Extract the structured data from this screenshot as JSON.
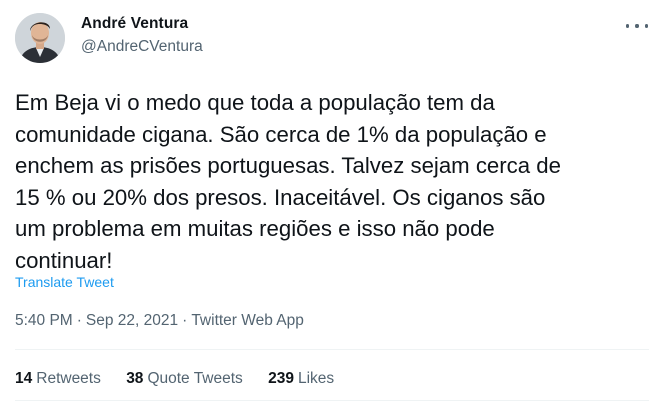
{
  "author": {
    "name": "André Ventura",
    "handle": "@AndreCVentura"
  },
  "tweet": {
    "lines": [
      "Em Beja vi o medo que toda a população tem da",
      "comunidade cigana. São cerca de 1% da população e",
      "enchem as prisões portuguesas. Talvez sejam cerca de",
      "15 % ou 20% dos presos. Inaceitável. Os ciganos são",
      "um problema em muitas regiões e isso não pode",
      "continuar!"
    ],
    "translate_label": "Translate Tweet",
    "time": "5:40 PM",
    "date": "Sep 22, 2021",
    "source": "Twitter Web App",
    "separator": "·"
  },
  "stats": {
    "retweets_count": "14",
    "retweets_label": "Retweets",
    "quote_tweets_count": "38",
    "quote_tweets_label": "Quote Tweets",
    "likes_count": "239",
    "likes_label": "Likes"
  },
  "icons": {
    "more": "more-horizontal-icon"
  },
  "colors": {
    "text": "#0f1419",
    "secondary": "#536471",
    "link": "#1d9bf0",
    "divider": "#eff3f4"
  }
}
